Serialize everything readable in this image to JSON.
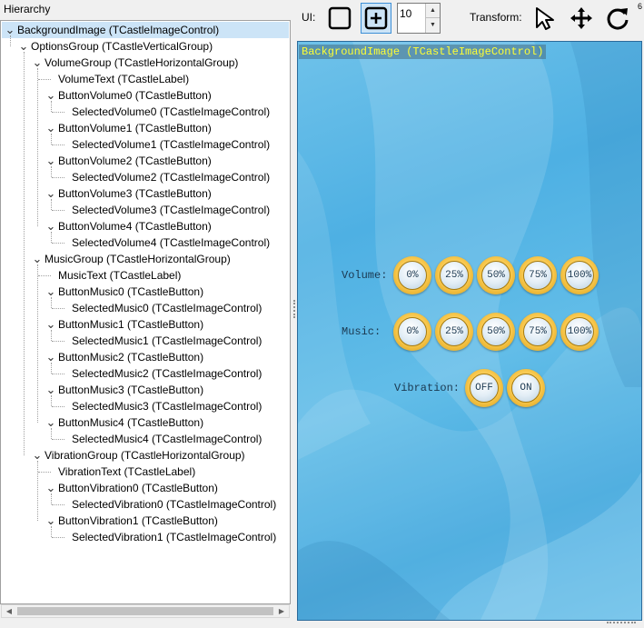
{
  "hierarchy": {
    "label": "Hierarchy",
    "nodes": [
      {
        "text": "BackgroundImage (TCastleImageControl)",
        "depth": 0,
        "expanded": true,
        "selected": true
      },
      {
        "text": "OptionsGroup (TCastleVerticalGroup)",
        "depth": 1,
        "expanded": true
      },
      {
        "text": "VolumeGroup (TCastleHorizontalGroup)",
        "depth": 2,
        "expanded": true
      },
      {
        "text": "VolumeText (TCastleLabel)",
        "depth": 3,
        "expanded": false
      },
      {
        "text": "ButtonVolume0 (TCastleButton)",
        "depth": 3,
        "expanded": true
      },
      {
        "text": "SelectedVolume0 (TCastleImageControl)",
        "depth": 4,
        "expanded": false
      },
      {
        "text": "ButtonVolume1 (TCastleButton)",
        "depth": 3,
        "expanded": true
      },
      {
        "text": "SelectedVolume1 (TCastleImageControl)",
        "depth": 4,
        "expanded": false
      },
      {
        "text": "ButtonVolume2 (TCastleButton)",
        "depth": 3,
        "expanded": true
      },
      {
        "text": "SelectedVolume2 (TCastleImageControl)",
        "depth": 4,
        "expanded": false
      },
      {
        "text": "ButtonVolume3 (TCastleButton)",
        "depth": 3,
        "expanded": true
      },
      {
        "text": "SelectedVolume3 (TCastleImageControl)",
        "depth": 4,
        "expanded": false
      },
      {
        "text": "ButtonVolume4 (TCastleButton)",
        "depth": 3,
        "expanded": true
      },
      {
        "text": "SelectedVolume4 (TCastleImageControl)",
        "depth": 4,
        "expanded": false
      },
      {
        "text": "MusicGroup (TCastleHorizontalGroup)",
        "depth": 2,
        "expanded": true
      },
      {
        "text": "MusicText (TCastleLabel)",
        "depth": 3,
        "expanded": false
      },
      {
        "text": "ButtonMusic0 (TCastleButton)",
        "depth": 3,
        "expanded": true
      },
      {
        "text": "SelectedMusic0 (TCastleImageControl)",
        "depth": 4,
        "expanded": false
      },
      {
        "text": "ButtonMusic1 (TCastleButton)",
        "depth": 3,
        "expanded": true
      },
      {
        "text": "SelectedMusic1 (TCastleImageControl)",
        "depth": 4,
        "expanded": false
      },
      {
        "text": "ButtonMusic2 (TCastleButton)",
        "depth": 3,
        "expanded": true
      },
      {
        "text": "SelectedMusic2 (TCastleImageControl)",
        "depth": 4,
        "expanded": false
      },
      {
        "text": "ButtonMusic3 (TCastleButton)",
        "depth": 3,
        "expanded": true
      },
      {
        "text": "SelectedMusic3 (TCastleImageControl)",
        "depth": 4,
        "expanded": false
      },
      {
        "text": "ButtonMusic4 (TCastleButton)",
        "depth": 3,
        "expanded": true
      },
      {
        "text": "SelectedMusic4 (TCastleImageControl)",
        "depth": 4,
        "expanded": false
      },
      {
        "text": "VibrationGroup (TCastleHorizontalGroup)",
        "depth": 2,
        "expanded": true
      },
      {
        "text": "VibrationText (TCastleLabel)",
        "depth": 3,
        "expanded": false
      },
      {
        "text": "ButtonVibration0 (TCastleButton)",
        "depth": 3,
        "expanded": true
      },
      {
        "text": "SelectedVibration0 (TCastleImageControl)",
        "depth": 4,
        "expanded": false
      },
      {
        "text": "ButtonVibration1 (TCastleButton)",
        "depth": 3,
        "expanded": true
      },
      {
        "text": "SelectedVibration1 (TCastleImageControl)",
        "depth": 4,
        "expanded": false
      }
    ]
  },
  "toolbar": {
    "ui_label": "UI:",
    "spin_value": "10",
    "transform_label": "Transform:",
    "corner_number": "6",
    "icons": [
      "square-outline-icon",
      "add-control-icon",
      "select-arrow-icon",
      "move-arrows-icon",
      "rotate-icon"
    ]
  },
  "viewport": {
    "title": "BackgroundImage (TCastleImageControl)",
    "volume_label": "Volume:",
    "volume_buttons": [
      "0%",
      "25%",
      "50%",
      "75%",
      "100%"
    ],
    "music_label": "Music:",
    "music_buttons": [
      "0%",
      "25%",
      "50%",
      "75%",
      "100%"
    ],
    "vibration_label": "Vibration:",
    "vibration_buttons": [
      "OFF",
      "ON"
    ]
  },
  "colors": {
    "selection": "#cce4f7",
    "viewport_blue": "#4eb0e3",
    "ring_gold": "#f7c64a",
    "title_yellow": "#ffff33"
  }
}
